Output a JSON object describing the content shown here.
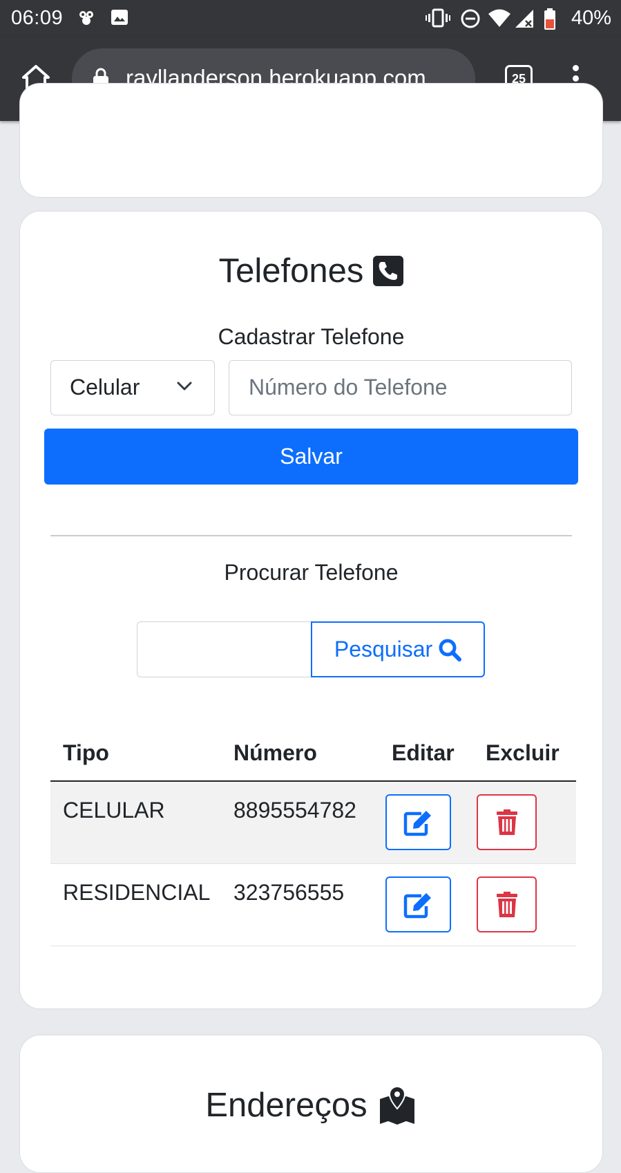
{
  "statusbar": {
    "time": "06:09",
    "battery": "40%"
  },
  "browser": {
    "url": "rayllanderson.herokuapp.com",
    "tab_count": "25"
  },
  "phones_card": {
    "title": "Telefones",
    "register_label": "Cadastrar Telefone",
    "type_select_value": "Celular",
    "number_placeholder": "Número do Telefone",
    "save_label": "Salvar",
    "search_label": "Procurar Telefone",
    "search_button_label": "Pesquisar",
    "table": {
      "headers": [
        "Tipo",
        "Número",
        "Editar",
        "Excluir"
      ],
      "rows": [
        {
          "tipo": "CELULAR",
          "numero": "8895554782"
        },
        {
          "tipo": "RESIDENCIAL",
          "numero": "323756555"
        }
      ]
    }
  },
  "address_card": {
    "title": "Endereços"
  },
  "colors": {
    "primary": "#0d6efd",
    "danger": "#dc3545",
    "browser_chrome": "#35363a",
    "page_bg": "#e9eaee"
  }
}
